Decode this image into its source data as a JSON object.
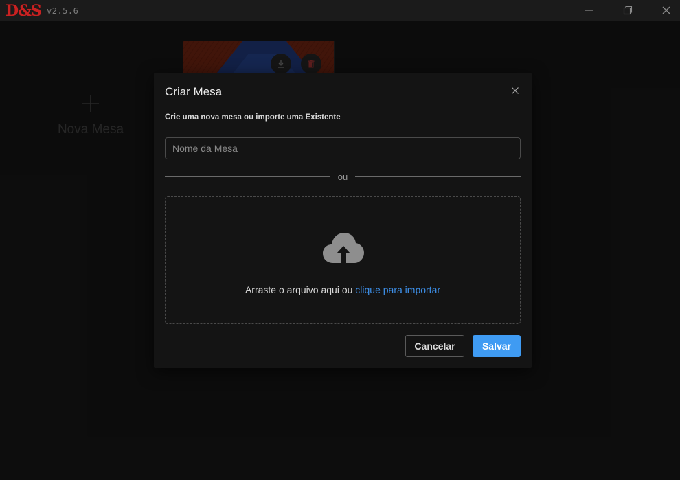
{
  "app": {
    "logo_text": "D&S",
    "version": "v2.5.6"
  },
  "window_controls": [
    "minimize-icon",
    "maximize-icon",
    "close-icon"
  ],
  "background": {
    "new_table_label": "Nova Mesa",
    "card_actions": [
      "download-icon",
      "trash-icon"
    ]
  },
  "modal": {
    "title": "Criar Mesa",
    "subtitle": "Crie uma nova mesa ou importe uma Existente",
    "name_input": {
      "value": "",
      "placeholder": "Nome da Mesa"
    },
    "divider_text": "ou",
    "dropzone": {
      "icon": "cloud-upload-icon",
      "text": "Arraste o arquivo aqui ou",
      "link": "clique para importar"
    },
    "cancel_label": "Cancelar",
    "save_label": "Salvar"
  },
  "colors": {
    "accent": "#3f9bf3",
    "link": "#3d8fe8",
    "logo": "#c92222",
    "background": "#181818",
    "modal": "#141414"
  }
}
